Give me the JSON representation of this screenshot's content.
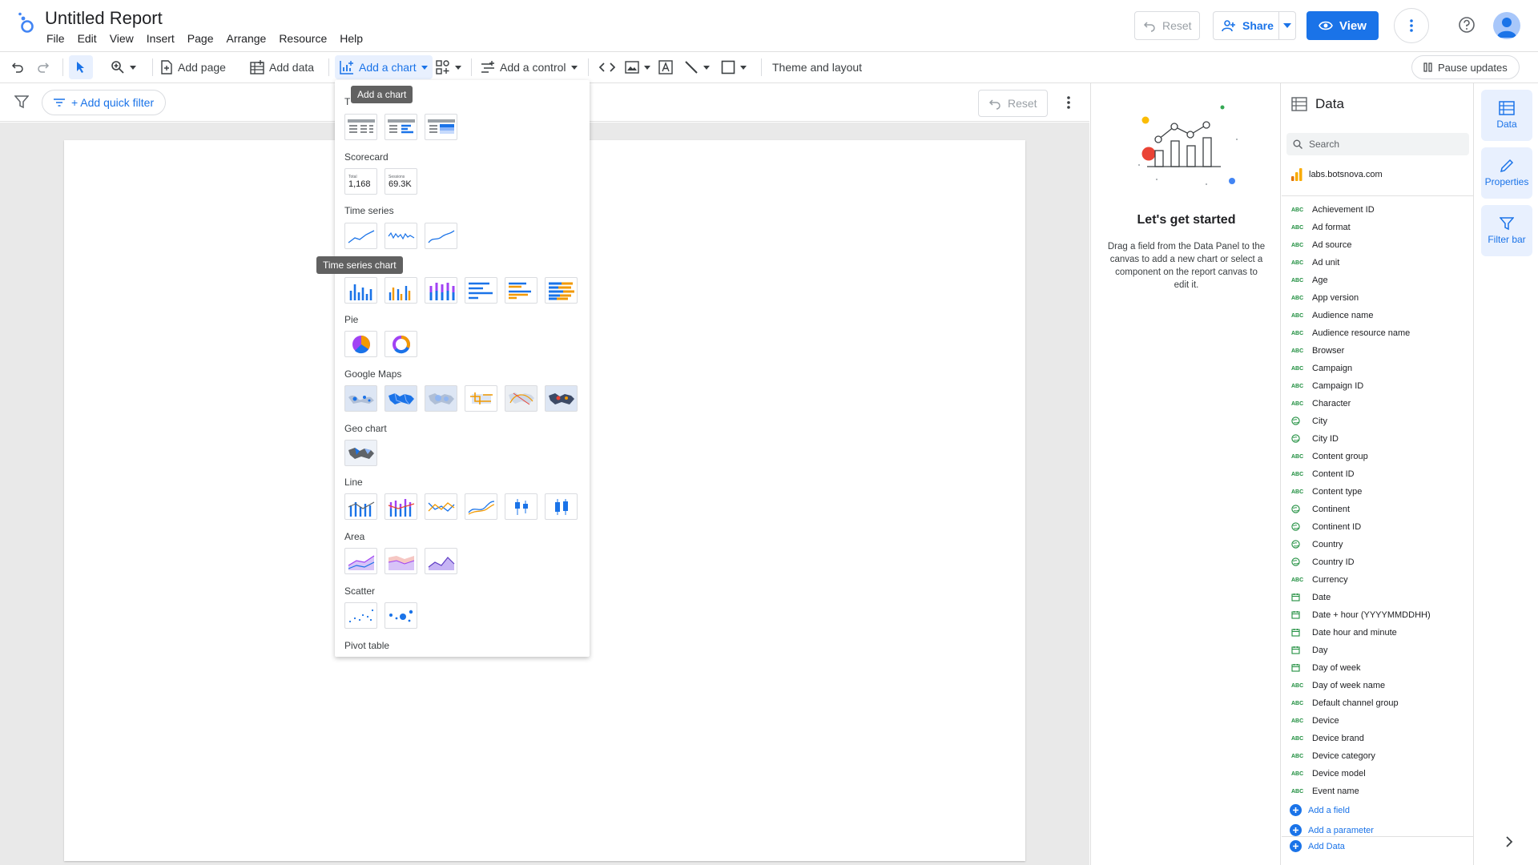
{
  "app": {
    "title": "Untitled Report",
    "menu": [
      "File",
      "Edit",
      "View",
      "Insert",
      "Page",
      "Arrange",
      "Resource",
      "Help"
    ],
    "reset_label": "Reset",
    "share_label": "Share",
    "view_label": "View"
  },
  "toolbar": {
    "add_page": "Add page",
    "add_data": "Add data",
    "add_chart": "Add a chart",
    "add_control": "Add a control",
    "theme_layout": "Theme and layout",
    "pause_updates": "Pause updates"
  },
  "filterbar": {
    "add_quick_filter": "+ Add quick filter",
    "reset_label": "Reset"
  },
  "chart_menu": {
    "tooltip_add_chart": "Add a chart",
    "tooltip_time_series": "Time series chart",
    "table_label_partial": "T",
    "scorecard_label": "Scorecard",
    "scorecard_1_caption": "Total",
    "scorecard_1_value": "1,168",
    "scorecard_2_caption": "Sessions",
    "scorecard_2_value": "69.3K",
    "time_series_label": "Time series",
    "pie_label": "Pie",
    "google_maps_label": "Google Maps",
    "geo_chart_label": "Geo chart",
    "line_label": "Line",
    "area_label": "Area",
    "scatter_label": "Scatter",
    "pivot_table_label": "Pivot table"
  },
  "get_started": {
    "title": "Let's get started",
    "text": "Drag a field from the Data Panel to the canvas to add a new chart or select a component on the report canvas to edit it."
  },
  "data_panel": {
    "title": "Data",
    "search_placeholder": "Search",
    "source": "labs.botsnova.com",
    "fields": [
      {
        "name": "Achievement ID",
        "type": "text"
      },
      {
        "name": "Ad format",
        "type": "text"
      },
      {
        "name": "Ad source",
        "type": "text"
      },
      {
        "name": "Ad unit",
        "type": "text"
      },
      {
        "name": "Age",
        "type": "text"
      },
      {
        "name": "App version",
        "type": "text"
      },
      {
        "name": "Audience name",
        "type": "text"
      },
      {
        "name": "Audience resource name",
        "type": "text"
      },
      {
        "name": "Browser",
        "type": "text"
      },
      {
        "name": "Campaign",
        "type": "text"
      },
      {
        "name": "Campaign ID",
        "type": "text"
      },
      {
        "name": "Character",
        "type": "text"
      },
      {
        "name": "City",
        "type": "geo"
      },
      {
        "name": "City ID",
        "type": "geo"
      },
      {
        "name": "Content group",
        "type": "text"
      },
      {
        "name": "Content ID",
        "type": "text"
      },
      {
        "name": "Content type",
        "type": "text"
      },
      {
        "name": "Continent",
        "type": "geo"
      },
      {
        "name": "Continent ID",
        "type": "geo"
      },
      {
        "name": "Country",
        "type": "geo"
      },
      {
        "name": "Country ID",
        "type": "geo"
      },
      {
        "name": "Currency",
        "type": "text"
      },
      {
        "name": "Date",
        "type": "date"
      },
      {
        "name": "Date + hour (YYYYMMDDHH)",
        "type": "date"
      },
      {
        "name": "Date hour and minute",
        "type": "date"
      },
      {
        "name": "Day",
        "type": "date"
      },
      {
        "name": "Day of week",
        "type": "date"
      },
      {
        "name": "Day of week name",
        "type": "text"
      },
      {
        "name": "Default channel group",
        "type": "text"
      },
      {
        "name": "Device",
        "type": "text"
      },
      {
        "name": "Device brand",
        "type": "text"
      },
      {
        "name": "Device category",
        "type": "text"
      },
      {
        "name": "Device model",
        "type": "text"
      },
      {
        "name": "Event name",
        "type": "text"
      }
    ],
    "text_type_badge": "ABC",
    "add_field": "Add a field",
    "add_parameter": "Add a parameter",
    "add_data": "Add Data"
  },
  "rail": {
    "data": "Data",
    "properties": "Properties",
    "filter_bar": "Filter bar"
  },
  "colors": {
    "accent": "#1a73e8",
    "orange": "#f29900",
    "purple": "#a142f4",
    "red": "#ea4335",
    "green": "#34a853"
  }
}
